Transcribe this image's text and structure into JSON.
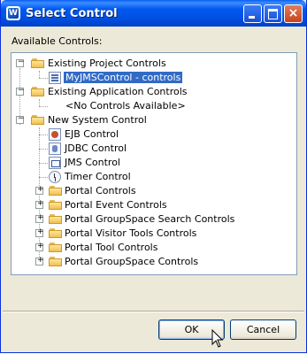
{
  "window": {
    "title": "Select Control",
    "app_icon_letter": "W"
  },
  "title_buttons": {
    "minimize": "minimize-icon",
    "maximize": "maximize-icon",
    "close": "×"
  },
  "section_label": "Available Controls:",
  "tree": {
    "existing_project": {
      "label": "Existing Project Controls",
      "expander": "−",
      "children": [
        "MyJMSControl - controls"
      ],
      "selected": "MyJMSControl - controls"
    },
    "existing_application": {
      "label": "Existing Application Controls",
      "expander": "−",
      "children": [
        "<No Controls Available>"
      ]
    },
    "new_system": {
      "label": "New System Control",
      "expander": "−",
      "leaf_children": [
        "EJB Control",
        "JDBC Control",
        "JMS Control",
        "Timer Control"
      ],
      "folder_children": [
        "Portal Controls",
        "Portal Event Controls",
        "Portal GroupSpace Search Controls",
        "Portal Visitor Tools Controls",
        "Portal Tool Controls",
        "Portal GroupSpace Controls"
      ],
      "collapsed_expander": "+"
    }
  },
  "buttons": {
    "ok": "OK",
    "cancel": "Cancel"
  },
  "colors": {
    "titlebar": "#0058ee",
    "selection": "#316ac5",
    "dialog_bg": "#ece9d8"
  }
}
